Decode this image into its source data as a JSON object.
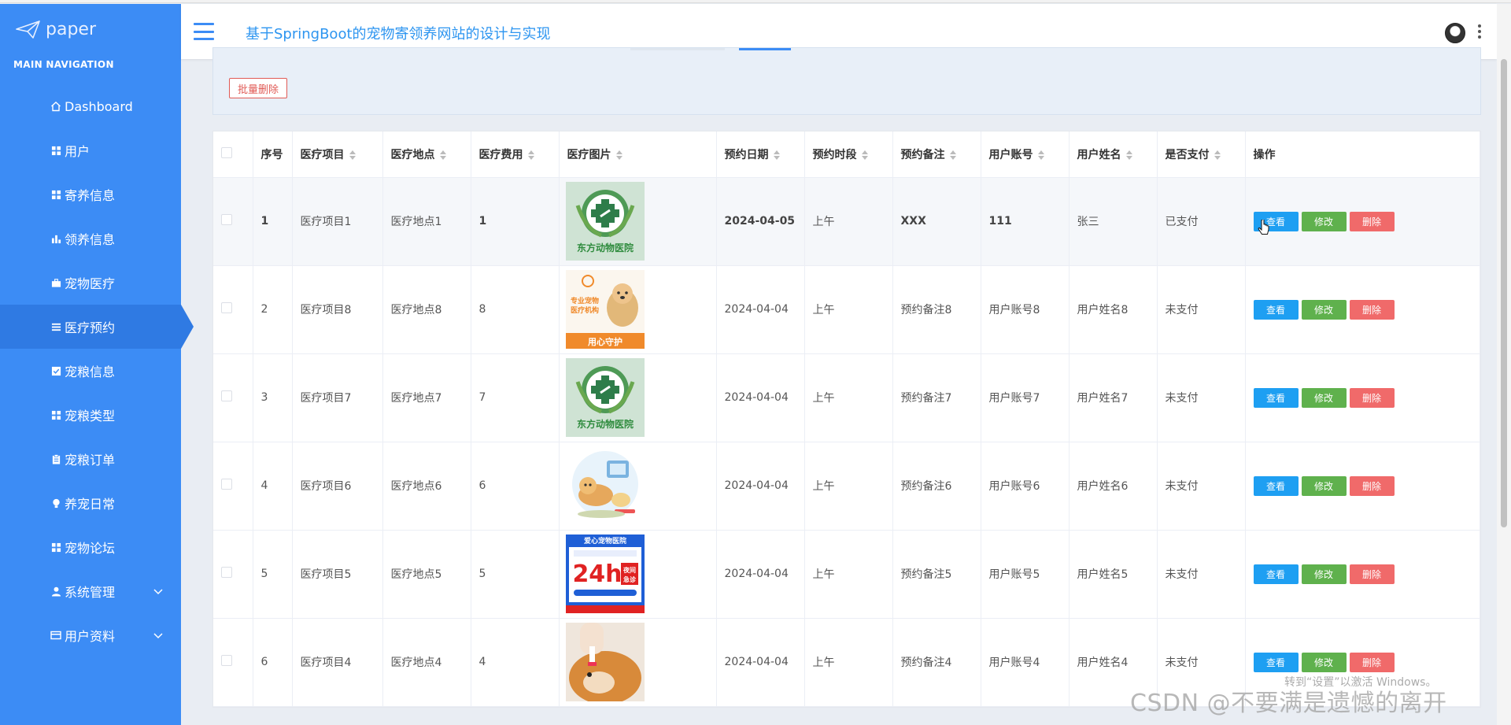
{
  "app": {
    "logo_text": "paper",
    "site_title": "基于SpringBoot的宠物寄领养网站的设计与实现"
  },
  "sidebar": {
    "section_title": "MAIN NAVIGATION",
    "items": [
      {
        "label": "Dashboard",
        "icon": "home-icon"
      },
      {
        "label": "用户",
        "icon": "grid-icon"
      },
      {
        "label": "寄养信息",
        "icon": "grid-icon"
      },
      {
        "label": "领养信息",
        "icon": "bar-chart-icon"
      },
      {
        "label": "宠物医疗",
        "icon": "briefcase-icon"
      },
      {
        "label": "医疗预约",
        "icon": "list-icon",
        "active": true
      },
      {
        "label": "宠粮信息",
        "icon": "check-square-icon"
      },
      {
        "label": "宠粮类型",
        "icon": "grid-icon"
      },
      {
        "label": "宠粮订单",
        "icon": "clipboard-icon"
      },
      {
        "label": "养宠日常",
        "icon": "bulb-icon"
      },
      {
        "label": "宠物论坛",
        "icon": "grid-icon"
      },
      {
        "label": "系统管理",
        "icon": "user-icon",
        "expandable": true
      },
      {
        "label": "用户资料",
        "icon": "card-icon",
        "expandable": true
      }
    ]
  },
  "toolbar": {
    "batch_delete_label": "批量删除"
  },
  "table": {
    "headers": [
      "序号",
      "医疗项目",
      "医疗地点",
      "医疗费用",
      "医疗图片",
      "预约日期",
      "预约时段",
      "预约备注",
      "用户账号",
      "用户姓名",
      "是否支付",
      "操作"
    ],
    "rows": [
      {
        "no": "1",
        "item": "医疗项目1",
        "place": "医疗地点1",
        "fee": "1",
        "image": "clinic-logo-green",
        "date": "2024-04-05",
        "slot": "上午",
        "note": "XXX",
        "account": "111",
        "name": "张三",
        "paid": "已支付"
      },
      {
        "no": "2",
        "item": "医疗项目8",
        "place": "医疗地点8",
        "fee": "8",
        "image": "pet-hospital-ad-dog",
        "date": "2024-04-04",
        "slot": "上午",
        "note": "预约备注8",
        "account": "用户账号8",
        "name": "用户姓名8",
        "paid": "未支付"
      },
      {
        "no": "3",
        "item": "医疗项目7",
        "place": "医疗地点7",
        "fee": "7",
        "image": "clinic-logo-green",
        "date": "2024-04-04",
        "slot": "上午",
        "note": "预约备注7",
        "account": "用户账号7",
        "name": "用户姓名7",
        "paid": "未支付"
      },
      {
        "no": "4",
        "item": "医疗项目6",
        "place": "医疗地点6",
        "fee": "6",
        "image": "cartoon-pets",
        "date": "2024-04-04",
        "slot": "上午",
        "note": "预约备注6",
        "account": "用户账号6",
        "name": "用户姓名6",
        "paid": "未支付"
      },
      {
        "no": "5",
        "item": "医疗项目5",
        "place": "医疗地点5",
        "fee": "5",
        "image": "24h-emergency-poster",
        "date": "2024-04-04",
        "slot": "上午",
        "note": "预约备注5",
        "account": "用户账号5",
        "name": "用户姓名5",
        "paid": "未支付"
      },
      {
        "no": "6",
        "item": "医疗项目4",
        "place": "医疗地点4",
        "fee": "4",
        "image": "shiba-dog-photo",
        "date": "2024-04-04",
        "slot": "上午",
        "note": "预约备注4",
        "account": "用户账号4",
        "name": "用户姓名4",
        "paid": "未支付"
      }
    ],
    "actions": {
      "view": "查看",
      "edit": "修改",
      "delete": "删除"
    }
  },
  "image_texts": {
    "clinic_name": "东方动物医院",
    "ad_headline": "专业宠物医疗机构",
    "ad_footer": "用心守护",
    "poster_brand": "爱心宠物医院",
    "poster_big": "24h",
    "poster_side": "夜间急诊"
  },
  "overlay": {
    "watermark": "CSDN @不要满是遗憾的离开",
    "windows_activate": "转到“设置”以激活 Windows。"
  },
  "colors": {
    "sidebar": "#3c8cf5",
    "sidebar_active": "#2f7ae3",
    "title": "#2d95f0",
    "view_button": "#1e9ff2",
    "edit_button": "#5fb14d",
    "delete_button": "#f06a6a"
  }
}
